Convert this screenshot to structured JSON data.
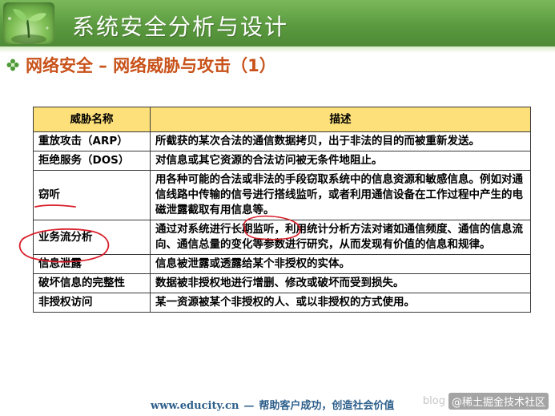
{
  "header": {
    "title": "系统安全分析与设计"
  },
  "subtitle": "网络安全 – 网络威胁与攻击（1）",
  "table": {
    "headers": [
      "威胁名称",
      "描述"
    ],
    "rows": [
      {
        "name": "重放攻击（ARP）",
        "description": "所截获的某次合法的通信数据拷贝，出于非法的目的而被重新发送。"
      },
      {
        "name": "拒绝服务（DOS）",
        "description": "对信息或其它资源的合法访问被无条件地阻止。"
      },
      {
        "name": "窃听",
        "description": "用各种可能的合法或非法的手段窃取系统中的信息资源和敏感信息。例如对通信线路中传输的信号进行搭线监听，或者利用通信设备在工作过程中产生的电磁泄露截取有用信息等。"
      },
      {
        "name": "业务流分析",
        "description": "通过对系统进行长期监听，利用统计分析方法对诸如通信频度、通信的信息流向、通信总量的变化等参数进行研究，从而发现有价值的信息和规律。"
      },
      {
        "name": "信息泄露",
        "description": "信息被泄露或透露给某个非授权的实体。"
      },
      {
        "name": "破坏信息的完整性",
        "description": "数据被非授权地进行增删、修改或破坏而受到损失。"
      },
      {
        "name": "非授权访问",
        "description": "某一资源被某个非授权的人、或以非授权的方式使用。"
      }
    ]
  },
  "footer": {
    "url": "www.educity.cn",
    "dash": "—",
    "slogan": "帮助客户成功，创造社会价值"
  },
  "watermark": {
    "blog": "blog",
    "text": "@稀土掘金技术社区"
  },
  "colors": {
    "header_green": "#5b9a3f",
    "subtitle_orange": "#c8521a",
    "table_header_yellow": "#fde07a",
    "annotation_red": "#d81e2a"
  }
}
